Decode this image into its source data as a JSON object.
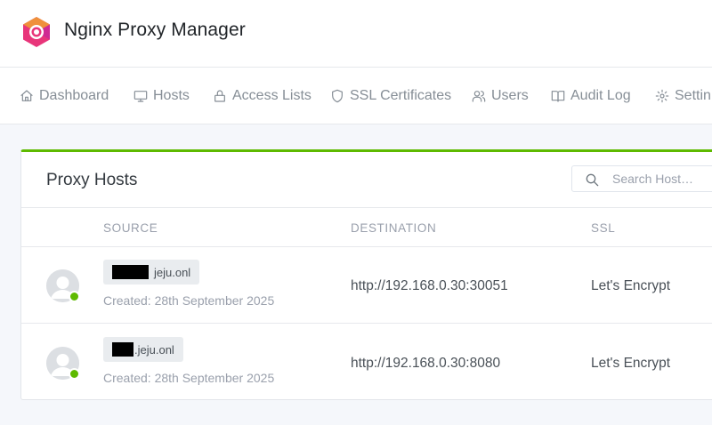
{
  "app": {
    "title": "Nginx Proxy Manager"
  },
  "nav": {
    "items": [
      {
        "label": "Dashboard",
        "icon": "home-icon"
      },
      {
        "label": "Hosts",
        "icon": "monitor-icon"
      },
      {
        "label": "Access Lists",
        "icon": "lock-icon"
      },
      {
        "label": "SSL Certificates",
        "icon": "shield-icon"
      },
      {
        "label": "Users",
        "icon": "users-icon"
      },
      {
        "label": "Audit Log",
        "icon": "book-open-icon"
      },
      {
        "label": "Settin",
        "icon": "gear-icon"
      }
    ]
  },
  "card": {
    "title": "Proxy Hosts",
    "search_placeholder": "Search Host…"
  },
  "table": {
    "columns": [
      "SOURCE",
      "DESTINATION",
      "SSL"
    ],
    "rows": [
      {
        "domain_suffix": "jeju.onl",
        "created": "Created: 28th September 2025",
        "destination": "http://192.168.0.30:30051",
        "ssl": "Let's Encrypt",
        "status": "online"
      },
      {
        "domain_suffix": ".jeju.onl",
        "created": "Created: 28th September 2025",
        "destination": "http://192.168.0.30:8080",
        "ssl": "Let's Encrypt",
        "status": "online"
      }
    ]
  },
  "colors": {
    "accent": "#5eba00",
    "logo_primary": "#e8357a",
    "logo_secondary": "#f28c28"
  }
}
